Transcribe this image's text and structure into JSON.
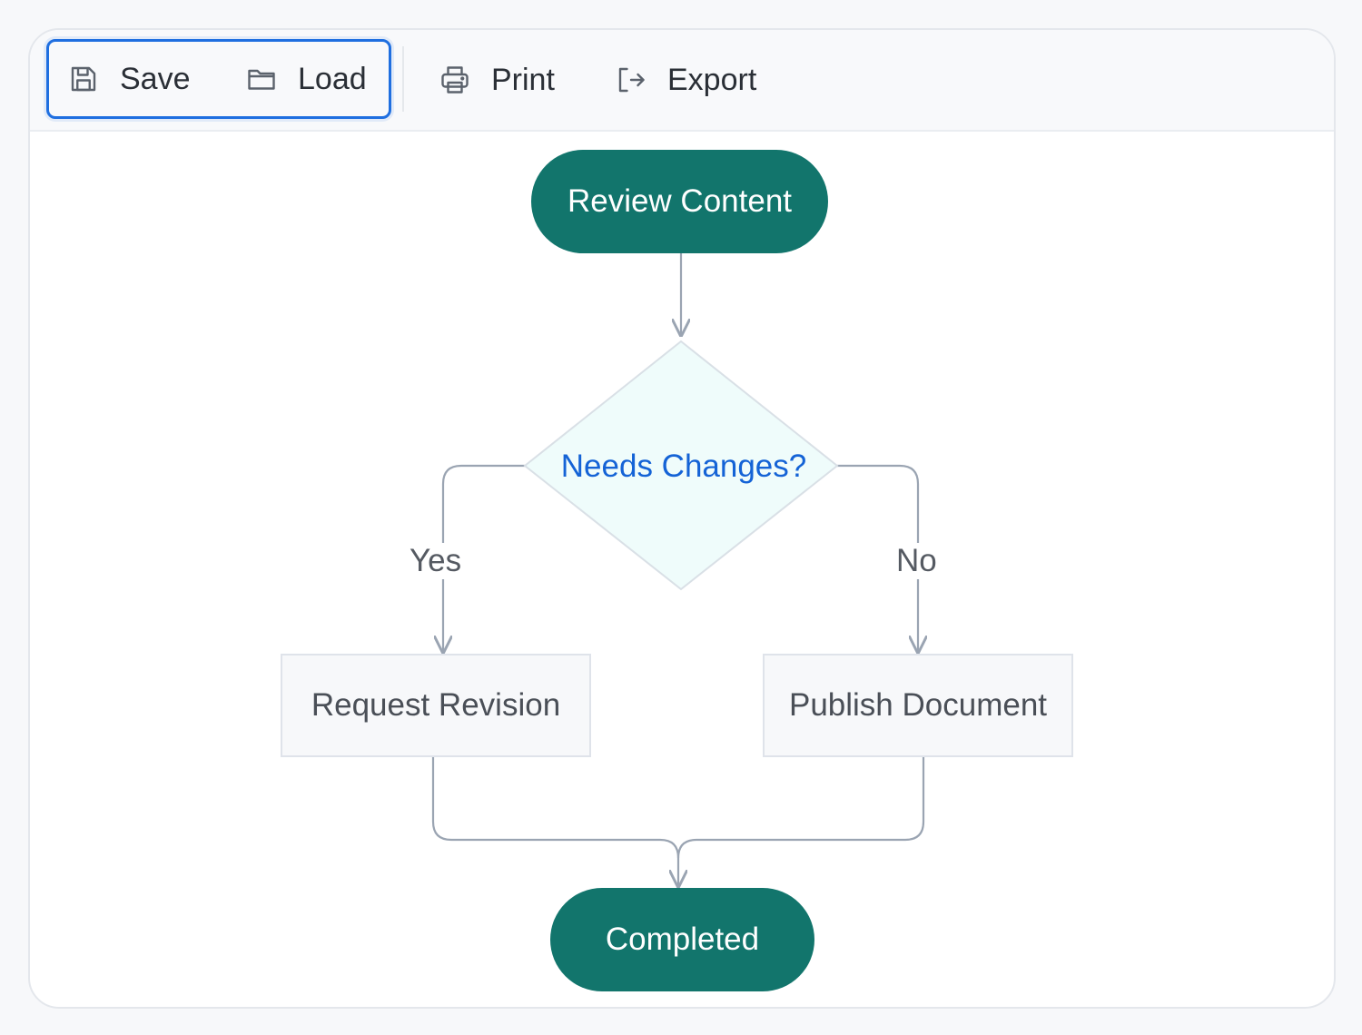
{
  "toolbar": {
    "save_label": "Save",
    "load_label": "Load",
    "print_label": "Print",
    "export_label": "Export"
  },
  "diagram": {
    "nodes": {
      "review": "Review Content",
      "decision": "Needs Changes?",
      "revision": "Request Revision",
      "publish": "Publish Document",
      "completed": "Completed"
    },
    "edges": {
      "yes": "Yes",
      "no": "No"
    }
  },
  "colors": {
    "terminal_fill": "#12756c",
    "decision_fill": "#effcfb",
    "decision_text": "#1463d6",
    "process_fill": "#f7f8fa",
    "connector": "#9aa4b2",
    "selection": "#1f6fe0"
  },
  "icons": [
    "save-icon",
    "folder-icon",
    "printer-icon",
    "export-icon"
  ]
}
